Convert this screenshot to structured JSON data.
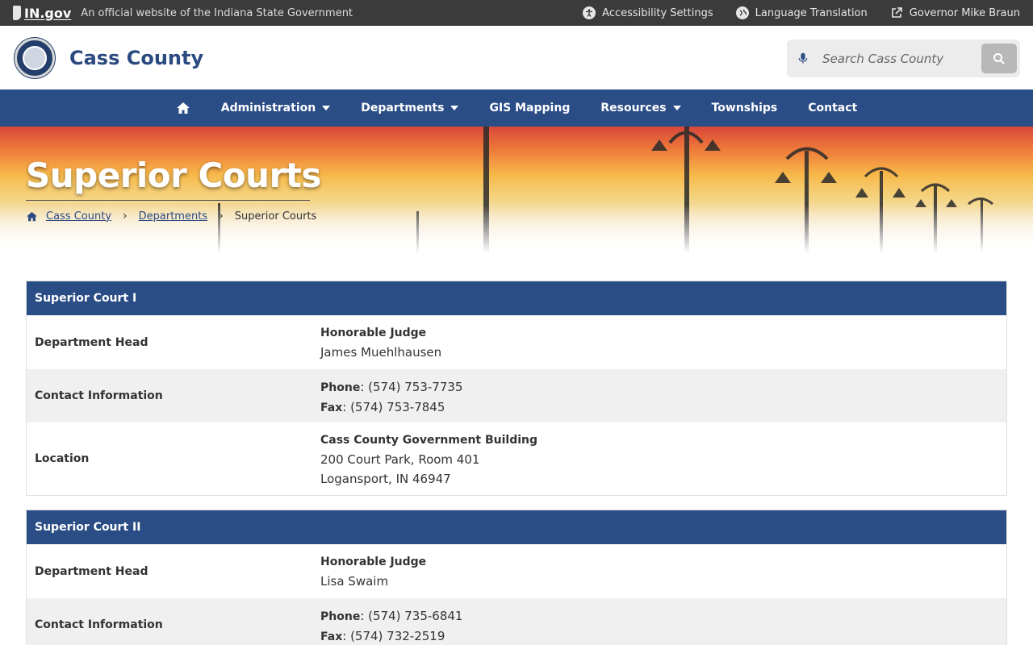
{
  "statebar": {
    "logo": "IN.gov",
    "official": "An official website of the Indiana State Government",
    "links": {
      "accessibility": "Accessibility Settings",
      "language": "Language Translation",
      "governor": "Governor Mike Braun"
    }
  },
  "header": {
    "title": "Cass County",
    "search_placeholder": "Search Cass County"
  },
  "nav": {
    "items": [
      "Administration",
      "Departments",
      "GIS Mapping",
      "Resources",
      "Townships",
      "Contact"
    ]
  },
  "hero": {
    "title": "Superior Courts",
    "breadcrumb": [
      "Cass County",
      "Departments",
      "Superior Courts"
    ]
  },
  "courts": [
    {
      "name": "Superior Court I",
      "head_label": "Department Head",
      "head_title": "Honorable Judge",
      "head_name": "James Muehlhausen",
      "contact_label": "Contact Information",
      "phone_label": "Phone",
      "phone": "(574) 753-7735",
      "fax_label": "Fax",
      "fax": "(574) 753-7845",
      "location_label": "Location",
      "location_building": "Cass County Government Building",
      "location_street": "200 Court Park, Room 401",
      "location_city": "Logansport, IN 46947"
    },
    {
      "name": "Superior Court II",
      "head_label": "Department Head",
      "head_title": "Honorable Judge",
      "head_name": "Lisa Swaim",
      "contact_label": "Contact Information",
      "phone_label": "Phone",
      "phone": "(574) 735-6841",
      "fax_label": "Fax",
      "fax": "(574) 732-2519"
    }
  ],
  "colors": {
    "navy": "#2b4d86",
    "statebar": "#3b3b3b"
  }
}
